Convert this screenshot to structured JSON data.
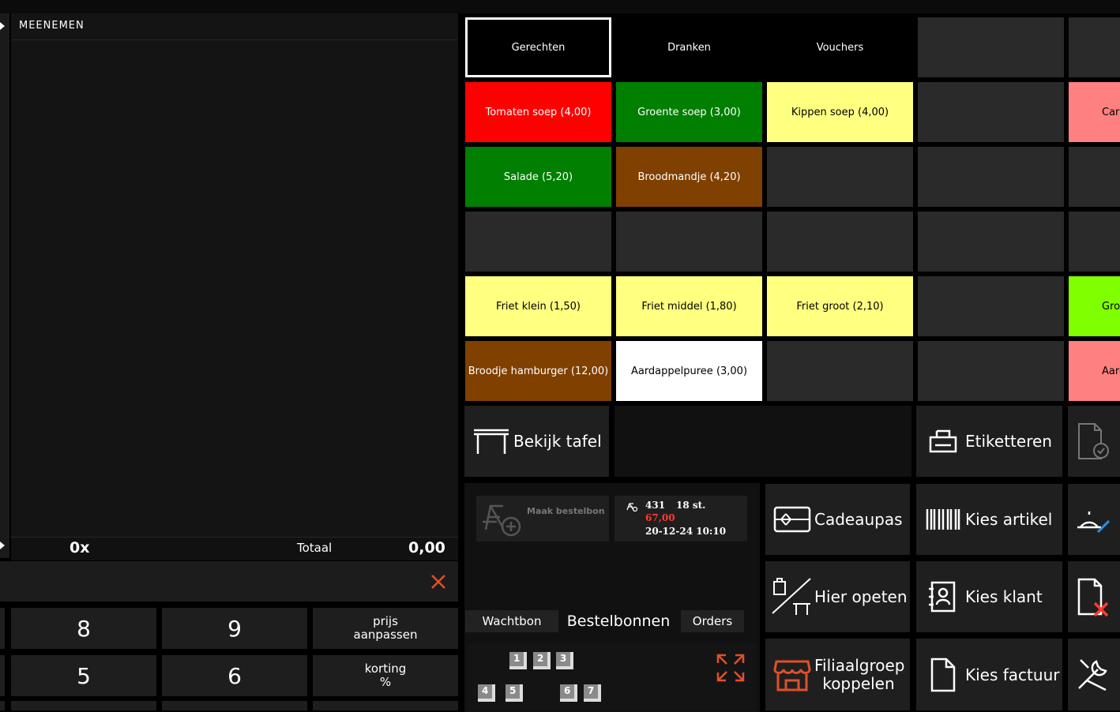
{
  "order": {
    "title": "MEENEMEN",
    "count": "0x",
    "total_label": "Totaal",
    "total_value": "0,00"
  },
  "keypad": [
    {
      "label": "8"
    },
    {
      "label": "9"
    },
    {
      "label": "prijs aanpassen"
    },
    {
      "label": "5"
    },
    {
      "label": "6"
    },
    {
      "label": "korting %"
    }
  ],
  "categories": [
    {
      "label": "Gerechten",
      "selected": true
    },
    {
      "label": "Dranken"
    },
    {
      "label": "Vouchers"
    },
    {
      "label": ""
    }
  ],
  "products": [
    [
      {
        "label": "Tomaten soep (4,00)",
        "color": "#ff0000"
      },
      {
        "label": "Groente soep (3,00)",
        "color": "#007f00"
      },
      {
        "label": "Kippen soep (4,00)",
        "color": "#ffff80"
      },
      {
        "label": ""
      },
      {
        "label": "Carp",
        "color": "#ff8080"
      }
    ],
    [
      {
        "label": "Salade (5,20)",
        "color": "#007f00"
      },
      {
        "label": "Broodmandje (4,20)",
        "color": "#7f4000"
      },
      {
        "label": ""
      },
      {
        "label": ""
      },
      {
        "label": ""
      }
    ],
    [
      {
        "label": ""
      },
      {
        "label": ""
      },
      {
        "label": ""
      },
      {
        "label": ""
      },
      {
        "label": ""
      }
    ],
    [
      {
        "label": "Friet klein (1,50)",
        "color": "#ffff80"
      },
      {
        "label": "Friet middel (1,80)",
        "color": "#ffff80"
      },
      {
        "label": "Friet groot (2,10)",
        "color": "#ffff80"
      },
      {
        "label": ""
      },
      {
        "label": "Groene",
        "color": "#80ff00"
      }
    ],
    [
      {
        "label": "Broodje hamburger (12,00)",
        "color": "#7f4000"
      },
      {
        "label": "Aardappelpuree (3,00)",
        "color": "#ffffff"
      },
      {
        "label": ""
      },
      {
        "label": ""
      },
      {
        "label": "Aard",
        "color": "#ff8080"
      }
    ]
  ],
  "actions": {
    "bekijk_tafel": "Bekijk tafel",
    "etiketteren": "Etiketteren",
    "cadeaupas": "Cadeaupas",
    "kies_artikel": "Kies artikel",
    "hier_opeten": "Hier opeten",
    "kies_klant": "Kies klant",
    "filiaalgroep": "Filiaalgroep koppelen",
    "kies_factuur": "Kies factuur"
  },
  "bestelbon": {
    "maak_label": "Maak bestelbon",
    "card_number": "431",
    "card_items": "18 st.",
    "card_amount": "67,00",
    "card_datetime": "20-12-24 10:10"
  },
  "tabs": [
    {
      "label": "Wachtbon"
    },
    {
      "label": "Bestelbonnen",
      "active": true
    },
    {
      "label": "Orders"
    }
  ],
  "tables": [
    "1",
    "2",
    "3",
    "4",
    "5",
    "6",
    "7"
  ]
}
